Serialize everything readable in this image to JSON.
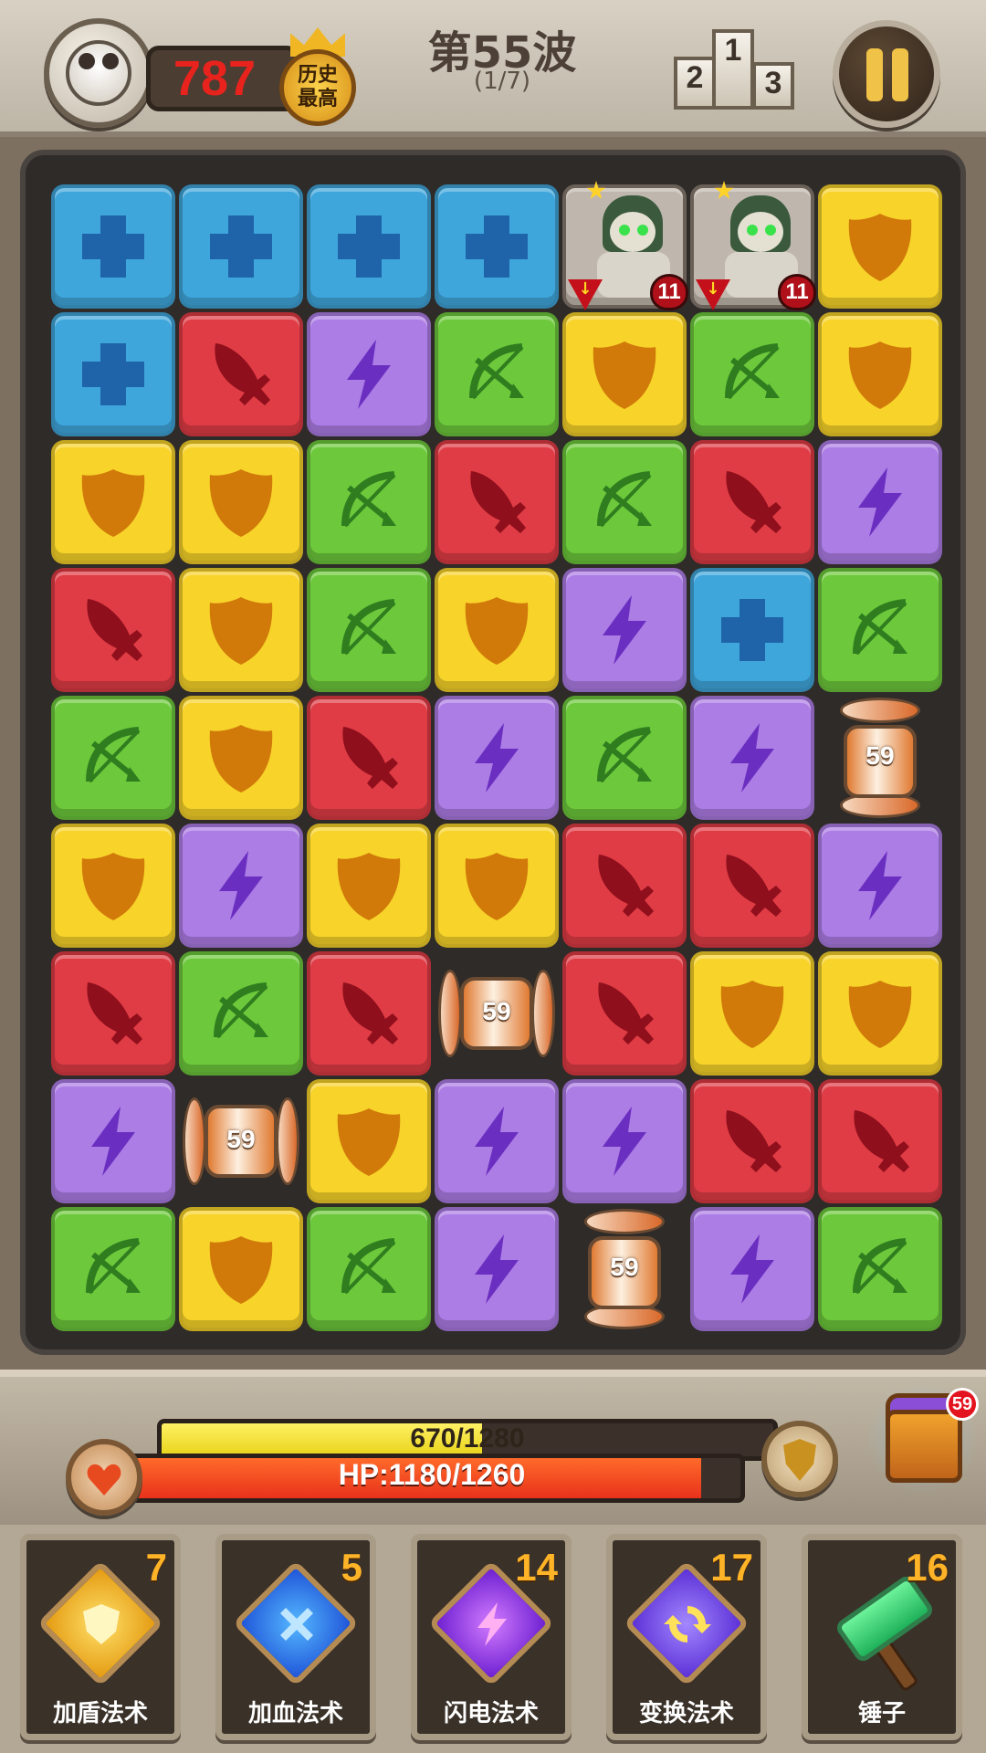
{
  "header": {
    "score": "787",
    "best_badge": "历史最高",
    "wave_title": "第55波",
    "wave_progress": "(1/7)",
    "podium_labels": [
      "1",
      "2",
      "3"
    ]
  },
  "board": {
    "columns": 7,
    "rows": 9,
    "tiles": [
      [
        "heal",
        "heal",
        "heal",
        "heal",
        "enemy",
        "enemy",
        "shield"
      ],
      [
        "heal",
        "sword",
        "lightning",
        "bow",
        "shield",
        "bow",
        "shield"
      ],
      [
        "shield",
        "shield",
        "bow",
        "sword",
        "bow",
        "sword",
        "lightning"
      ],
      [
        "sword",
        "shield",
        "bow",
        "shield",
        "lightning",
        "heal",
        "bow"
      ],
      [
        "bow",
        "shield",
        "sword",
        "lightning",
        "bow",
        "lightning",
        "bomb-v"
      ],
      [
        "shield",
        "lightning",
        "shield",
        "shield",
        "sword",
        "sword",
        "lightning"
      ],
      [
        "sword",
        "bow",
        "sword",
        "bomb-h",
        "sword",
        "shield",
        "shield"
      ],
      [
        "lightning",
        "bomb-h",
        "shield",
        "lightning",
        "lightning",
        "sword",
        "sword"
      ],
      [
        "bow",
        "shield",
        "bow",
        "lightning",
        "bomb-v",
        "lightning",
        "bow"
      ]
    ],
    "enemy_hp": "11",
    "bomb_timer": "59"
  },
  "status": {
    "xp_text": "670/1280",
    "xp_ratio": 0.5234,
    "hp_text": "HP:1180/1260",
    "hp_ratio": 0.9365,
    "chest_badge": "59"
  },
  "skills": [
    {
      "count": "7",
      "label": "加盾法术",
      "icon": "shield-spell-icon"
    },
    {
      "count": "5",
      "label": "加血法术",
      "icon": "heal-spell-icon"
    },
    {
      "count": "14",
      "label": "闪电法术",
      "icon": "lightning-spell-icon"
    },
    {
      "count": "17",
      "label": "变换法术",
      "icon": "transform-spell-icon"
    },
    {
      "count": "16",
      "label": "锤子",
      "icon": "hammer-icon"
    }
  ],
  "colors": {
    "heal": "#3fa6dc",
    "sword": "#e03c45",
    "lightning": "#ad7de6",
    "bow": "#6dc93b",
    "shield": "#f8d32a",
    "score": "#e8231d",
    "hp": "#e8321b",
    "xp": "#e8d318"
  }
}
